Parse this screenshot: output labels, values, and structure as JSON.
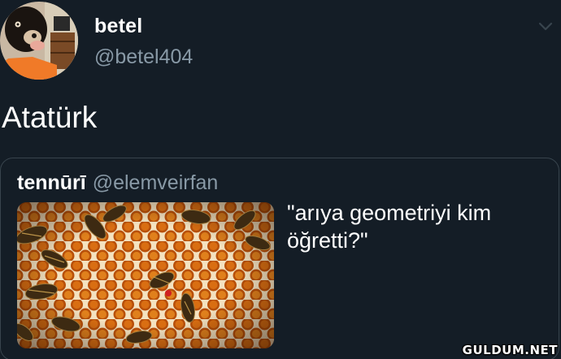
{
  "tweet": {
    "display_name": "betel",
    "handle": "@betel404",
    "text": "Atatürk",
    "menu_icon": "chevron-down-icon"
  },
  "quoted_tweet": {
    "display_name": "tennūrī",
    "handle": "@elemveirfan",
    "text": "\"arıya geometriyi kim öğretti?\"",
    "image": "honeycomb-with-bees-photo"
  },
  "watermark": "GULDUM.NET",
  "colors": {
    "background": "#141d26",
    "text_primary": "#ffffff",
    "text_secondary": "#8899a6",
    "border": "#38444d"
  }
}
